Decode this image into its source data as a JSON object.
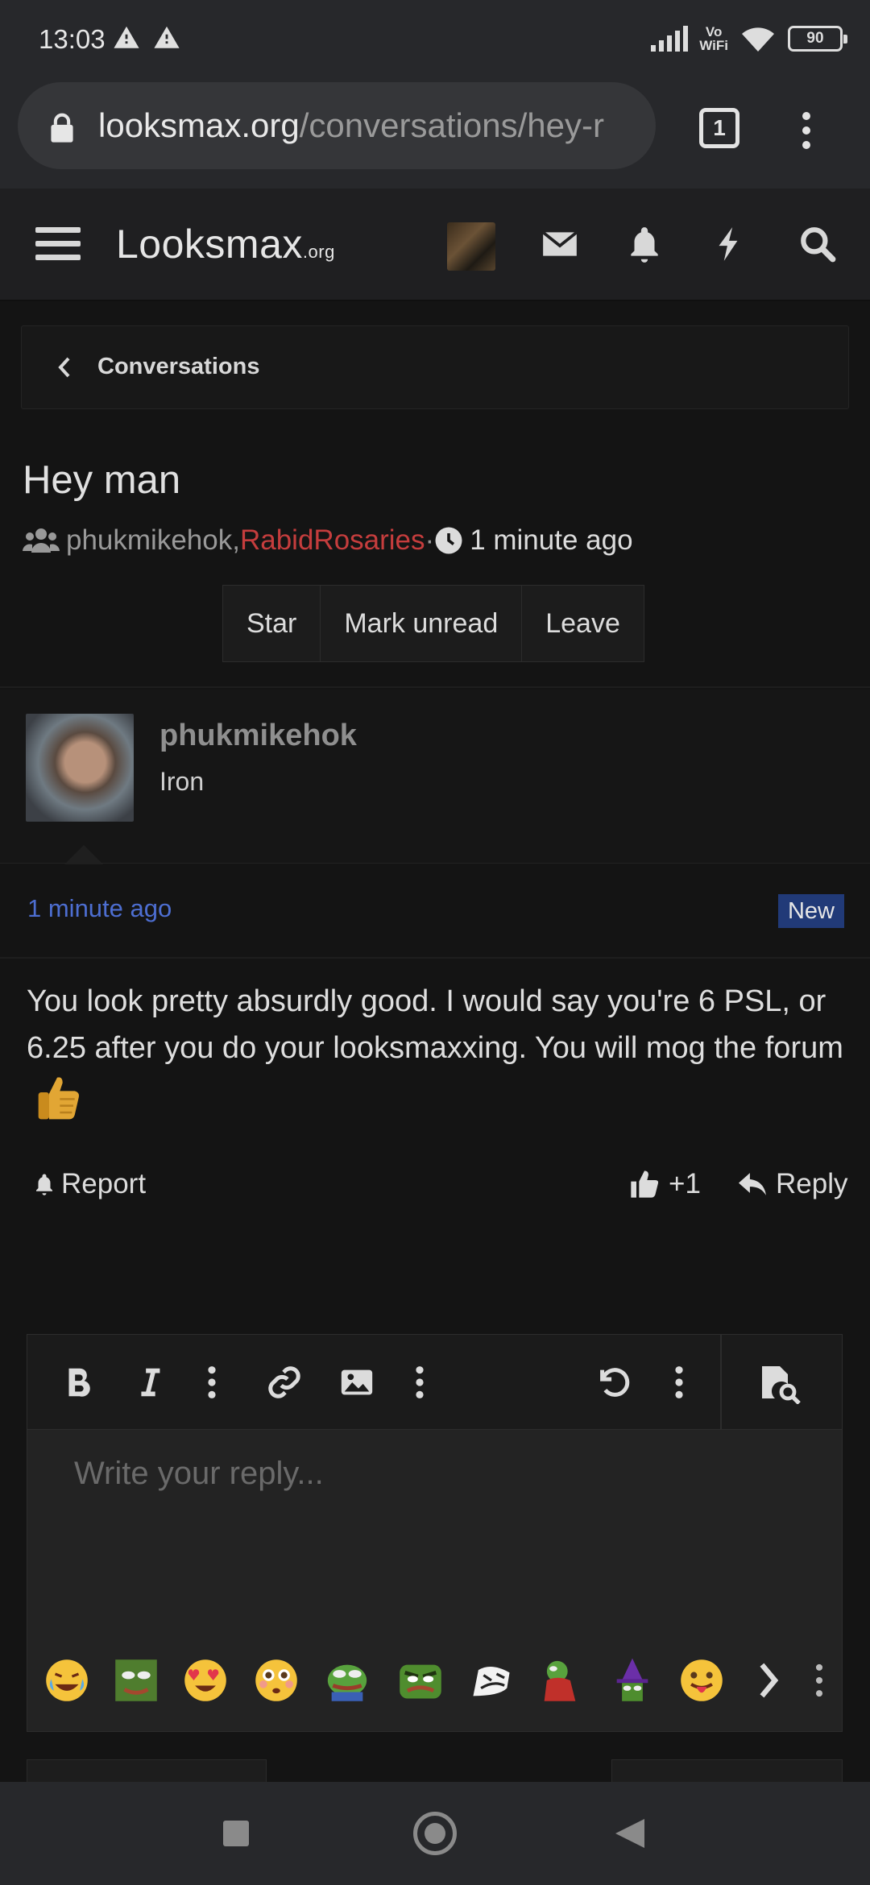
{
  "status_bar": {
    "time": "13:03",
    "network_label_1": "Vo",
    "network_label_2": "WiFi",
    "battery": "90"
  },
  "browser": {
    "url_host": "looksmax.org",
    "url_path": "/conversations/hey-r",
    "tab_count": "1"
  },
  "site": {
    "logo_main": "Looksmax",
    "logo_suffix": ".org"
  },
  "breadcrumb": {
    "label": "Conversations"
  },
  "conversation": {
    "title": "Hey man",
    "participant_1": "phukmikehok",
    "participant_sep": ", ",
    "participant_2": "RabidRosaries",
    "dot": " · ",
    "time": "1 minute ago",
    "actions": [
      "Star",
      "Mark unread",
      "Leave"
    ]
  },
  "message": {
    "username": "phukmikehok",
    "rank": "Iron",
    "time": "1 minute ago",
    "badge": "New",
    "body": "You look pretty absurdly good. I would say you're 6 PSL, or 6.25 after you do your looksmaxxing. You will mog the forum",
    "report_label": "Report",
    "like_count": "+1",
    "reply_label": "Reply"
  },
  "editor": {
    "placeholder": "Write your reply...",
    "toolbar_icons": [
      "bold-icon",
      "italic-icon",
      "more-icon",
      "link-icon",
      "image-icon",
      "more-icon",
      "undo-icon",
      "more-icon",
      "preview-icon"
    ],
    "emojis": [
      "joy-emoji",
      "pepe-mad-emoji",
      "heart-eyes-emoji",
      "flushed-emoji",
      "pepe-emoji",
      "pepe-angry-emoji",
      "meme-face-emoji",
      "pepe-red-emoji",
      "wizard-emoji",
      "tongue-emoji"
    ]
  },
  "colors": {
    "accent_red": "#c53d3d",
    "link_blue": "#4d6ed1",
    "badge_blue": "#213a78",
    "header_bg": "#1f1f21"
  }
}
